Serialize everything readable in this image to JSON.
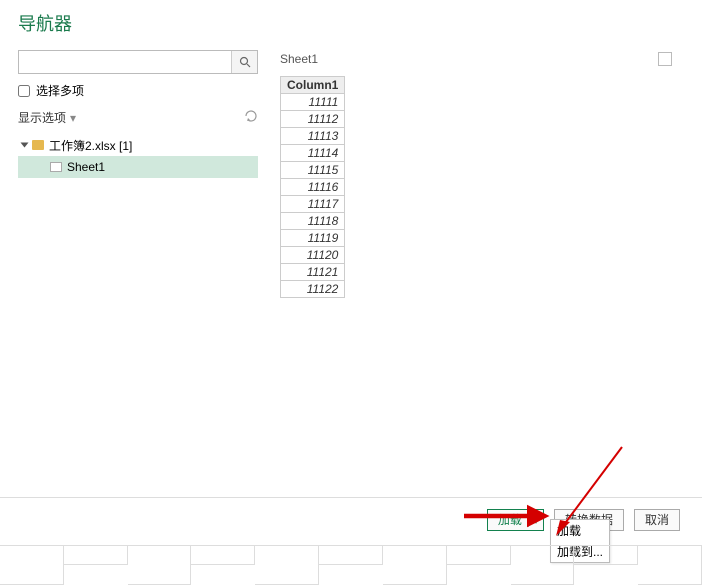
{
  "title": "导航器",
  "search": {
    "placeholder": ""
  },
  "multi_select_label": "选择多项",
  "display_options_label": "显示选项",
  "tree": {
    "file_label": "工作簿2.xlsx [1]",
    "sheet_label": "Sheet1"
  },
  "preview": {
    "title": "Sheet1",
    "column_header": "Column1",
    "rows": [
      "11111",
      "11112",
      "11113",
      "11114",
      "11115",
      "11116",
      "11117",
      "11118",
      "11119",
      "11120",
      "11121",
      "11122"
    ]
  },
  "footer": {
    "load_label": "加载",
    "transform_label": "转换数据",
    "cancel_label": "取消",
    "menu": {
      "load": "加载",
      "load_to": "加载到..."
    }
  }
}
